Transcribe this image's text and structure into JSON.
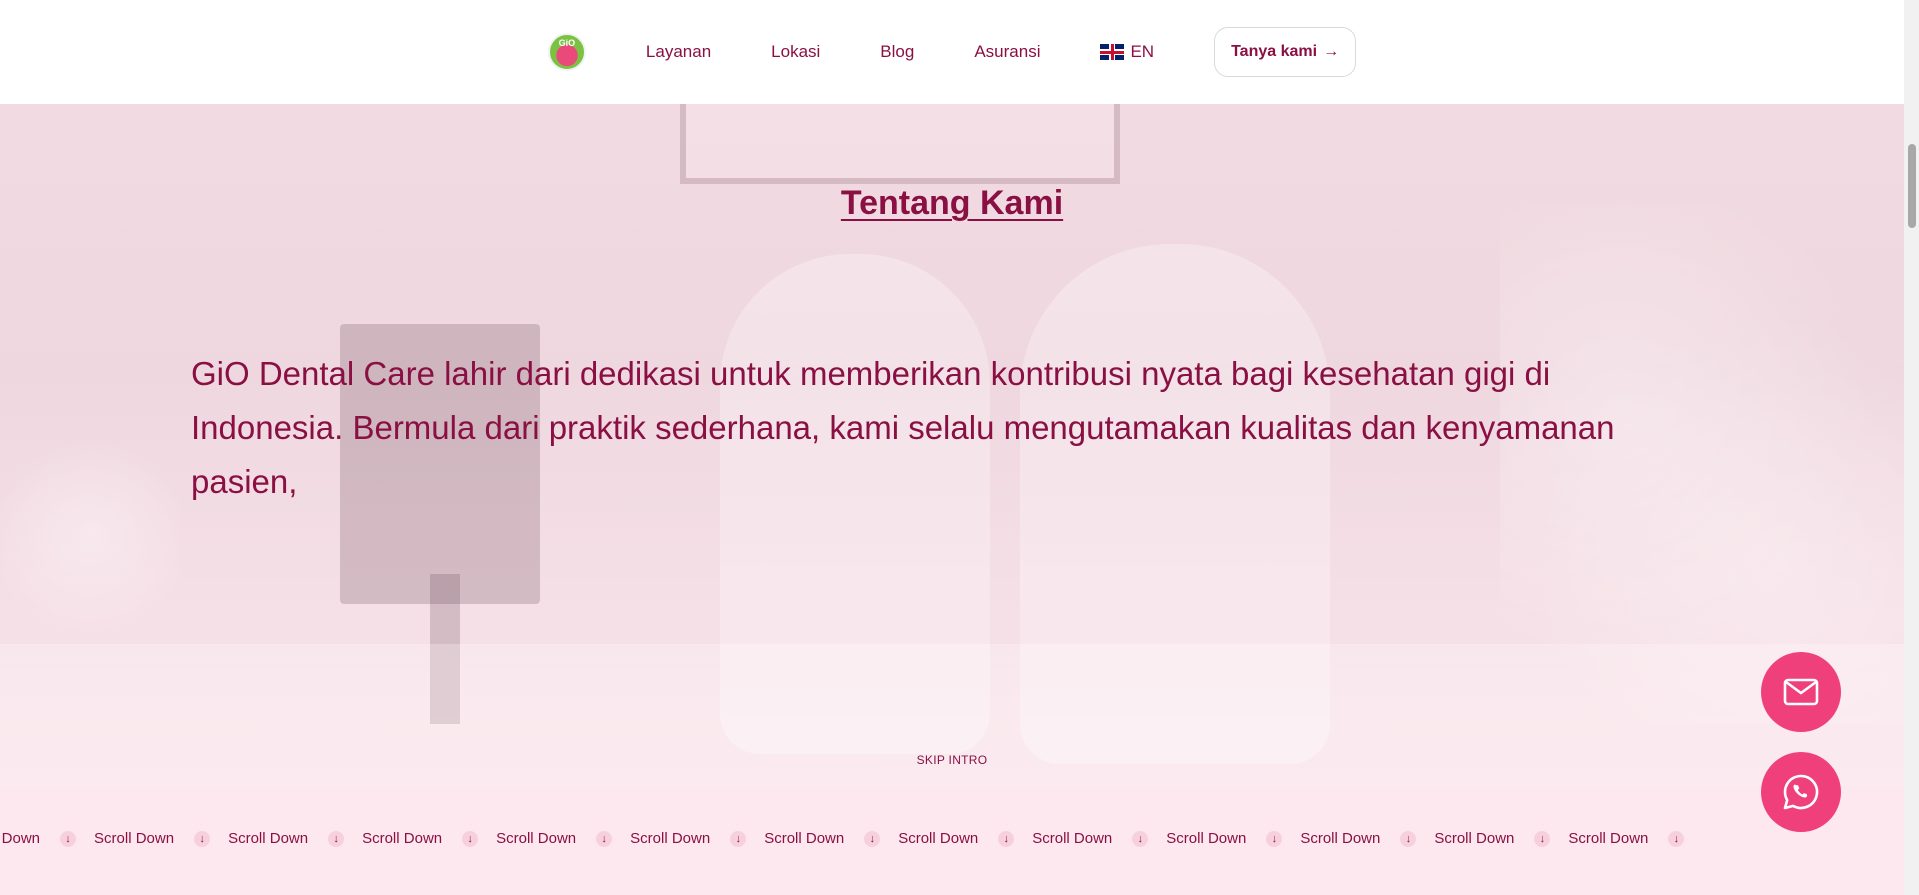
{
  "header": {
    "logo_text": "GiO",
    "nav": [
      "Layanan",
      "Lokasi",
      "Blog",
      "Asuransi"
    ],
    "lang_label": "EN",
    "cta_label": "Tanya kami",
    "cta_arrow": "→"
  },
  "hero": {
    "title": "Tentang Kami",
    "about": "GiO Dental Care lahir dari dedikasi untuk memberikan kontribusi nyata bagi kesehatan gigi di Indonesia. Bermula dari praktik sederhana, kami selalu mengutamakan kualitas dan kenyamanan pasien,",
    "skip_label": "SKIP INTRO"
  },
  "marquee": {
    "item_label": "Scroll Down",
    "icon": "↓",
    "repeat": 13
  },
  "colors": {
    "primary": "#8a1043",
    "fab": "#f0407b",
    "marquee_bg": "#fde8ef"
  },
  "icons": {
    "mail": "mail-icon",
    "whatsapp": "whatsapp-icon",
    "arrow_down": "arrow-down-icon",
    "flag": "uk-flag-icon"
  }
}
